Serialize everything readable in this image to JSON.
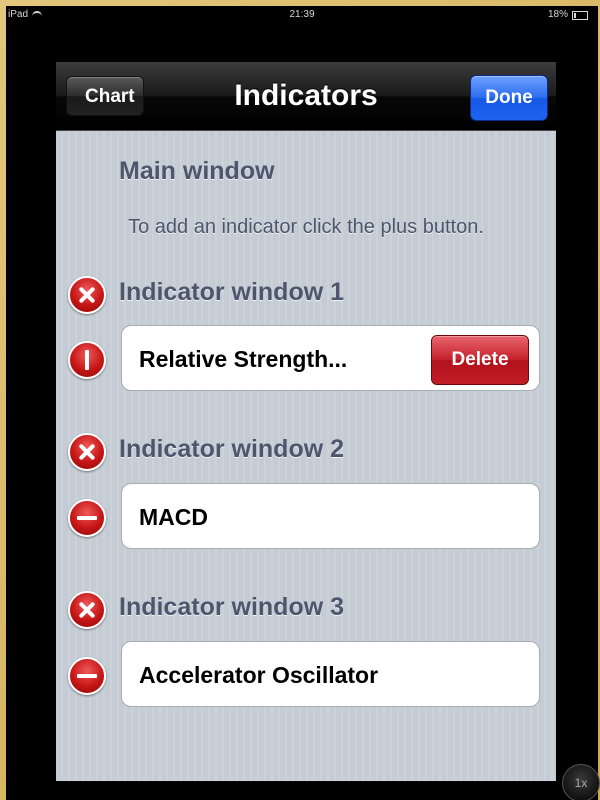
{
  "status_bar": {
    "device": "iPad",
    "time": "21:39",
    "battery": "18%"
  },
  "navbar": {
    "back_label": "Chart",
    "title": "Indicators",
    "done_label": "Done"
  },
  "main_window": {
    "header": "Main window",
    "hint": "To add an indicator click the plus button."
  },
  "indicator_windows": [
    {
      "header": "Indicator window 1",
      "indicator": "Relative Strength...",
      "delete_label": "Delete",
      "delete_confirm_shown": true
    },
    {
      "header": "Indicator window 2",
      "indicator": "MACD",
      "delete_confirm_shown": false
    },
    {
      "header": "Indicator window 3",
      "indicator": "Accelerator Oscillator",
      "delete_confirm_shown": false
    }
  ],
  "zoom_label": "1x",
  "colors": {
    "done_button": "#2a6cf0",
    "delete_button": "#c5202a",
    "section_text": "#4c566c",
    "table_background": "#c5ccd4"
  }
}
